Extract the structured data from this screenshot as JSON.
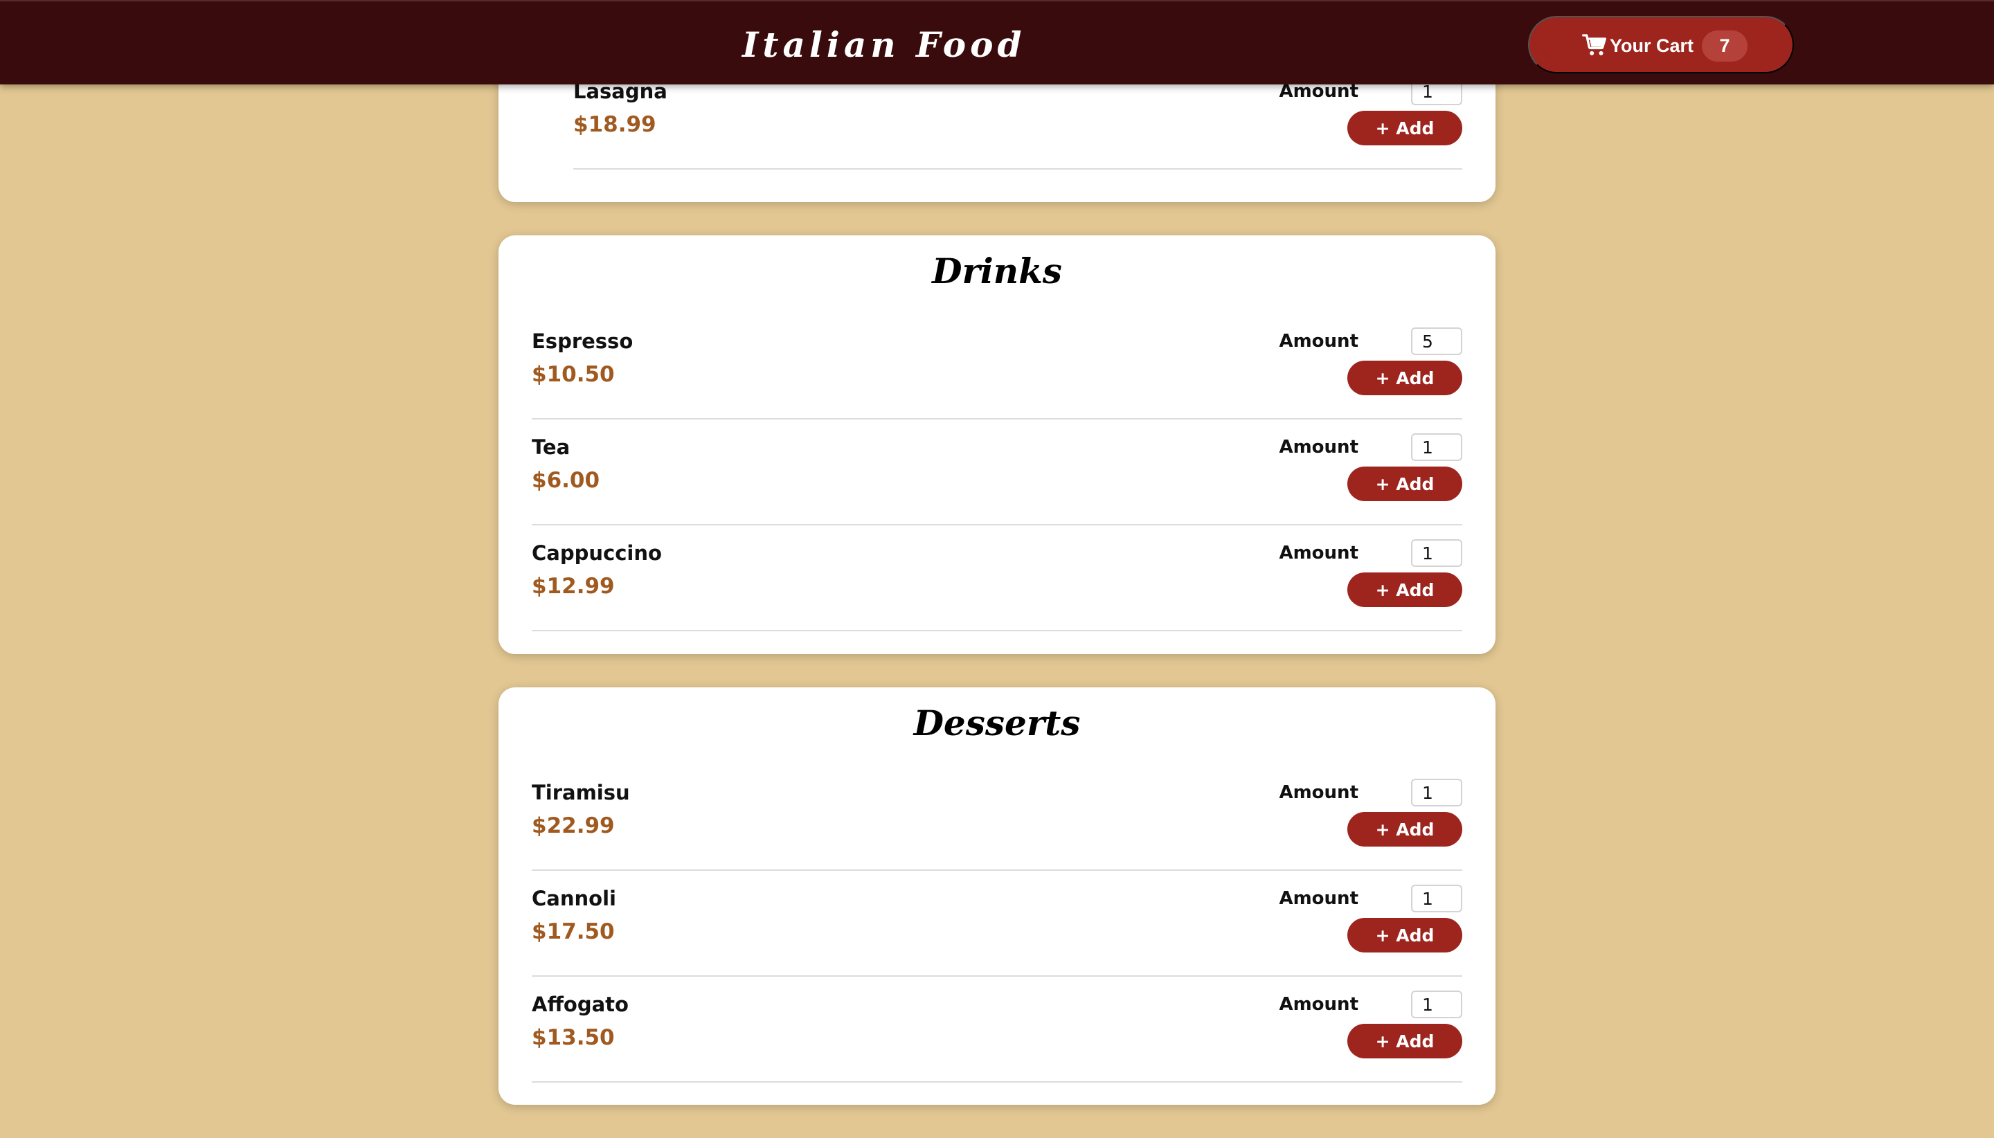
{
  "header": {
    "brand": "Italian Food",
    "cart": {
      "label": "Your Cart",
      "count": "7",
      "icon": "cart-icon"
    }
  },
  "colors": {
    "background": "#e2c792",
    "header": "#3a0b0d",
    "accent": "#9e241e",
    "price": "#a05a20",
    "card": "#ffffff"
  },
  "sections": {
    "main": {
      "items": [
        {
          "name": "Lasagna",
          "price": "$18.99",
          "amount_label": "Amount",
          "amount": "1",
          "add_label": "+ Add"
        }
      ]
    },
    "drinks": {
      "title": "Drinks",
      "items": [
        {
          "name": "Espresso",
          "price": "$10.50",
          "amount_label": "Amount",
          "amount": "5",
          "add_label": "+ Add"
        },
        {
          "name": "Tea",
          "price": "$6.00",
          "amount_label": "Amount",
          "amount": "1",
          "add_label": "+ Add"
        },
        {
          "name": "Cappuccino",
          "price": "$12.99",
          "amount_label": "Amount",
          "amount": "1",
          "add_label": "+ Add"
        }
      ]
    },
    "desserts": {
      "title": "Desserts",
      "items": [
        {
          "name": "Tiramisu",
          "price": "$22.99",
          "amount_label": "Amount",
          "amount": "1",
          "add_label": "+ Add"
        },
        {
          "name": "Cannoli",
          "price": "$17.50",
          "amount_label": "Amount",
          "amount": "1",
          "add_label": "+ Add"
        },
        {
          "name": "Affogato",
          "price": "$13.50",
          "amount_label": "Amount",
          "amount": "1",
          "add_label": "+ Add"
        }
      ]
    }
  }
}
